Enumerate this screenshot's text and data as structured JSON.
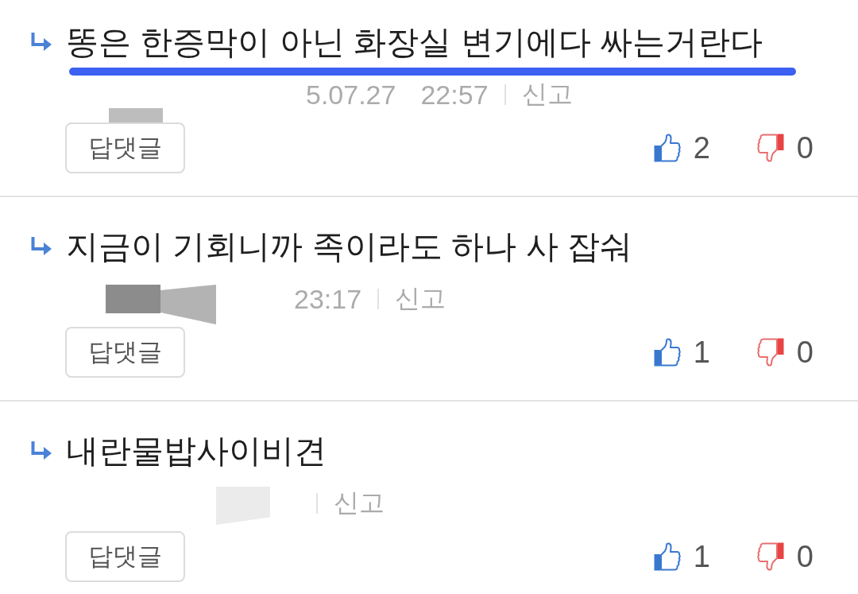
{
  "comments": [
    {
      "text": "똥은 한증막이 아닌 화장실 변기에다 싸는거란다",
      "underlined": true,
      "redactions": [
        {
          "kind": "small"
        }
      ],
      "date": "5.07.27",
      "time": "22:57",
      "report": "신고",
      "reply_button": "답댓글",
      "likes": "2",
      "dislikes": "0"
    },
    {
      "text": "지금이 기회니까 족이라도 하나 사 잡숴",
      "underlined": false,
      "redactions": [
        {
          "kind": "dark"
        },
        {
          "kind": "mid"
        }
      ],
      "time": "23:17",
      "report": "신고",
      "reply_button": "답댓글",
      "likes": "1",
      "dislikes": "0"
    },
    {
      "text": "내란물밥사이비견",
      "underlined": false,
      "redactions": [
        {
          "kind": "faint"
        }
      ],
      "report": "신고",
      "reply_button": "답댓글",
      "likes": "1",
      "dislikes": "0"
    }
  ]
}
